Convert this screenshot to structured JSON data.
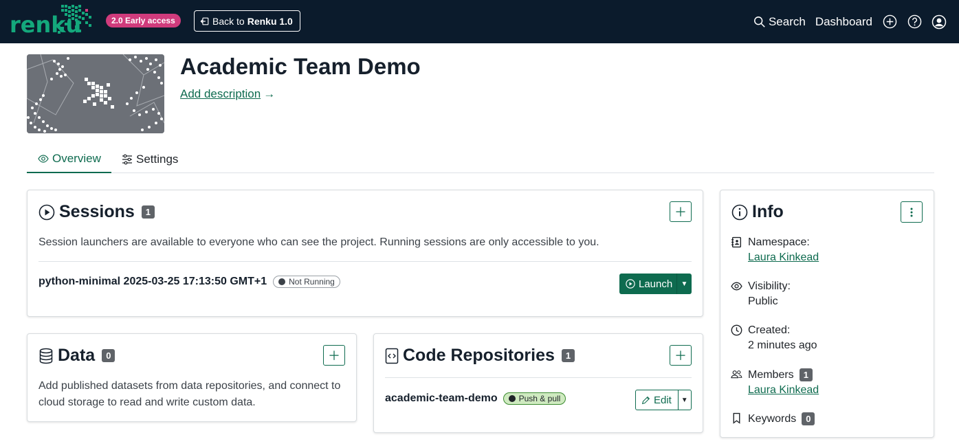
{
  "navbar": {
    "logo_text": "renku",
    "early_access_badge": "2.0 Early access",
    "back_button": {
      "prefix": "Back to ",
      "bold": "Renku 1.0"
    },
    "search_label": "Search",
    "dashboard_label": "Dashboard",
    "icons": [
      "search-icon",
      "plus-circle-icon",
      "help-circle-icon",
      "user-account-icon"
    ]
  },
  "project": {
    "title": "Academic Team Demo",
    "add_description": "Add description",
    "add_description_arrow": "→"
  },
  "tabs": [
    {
      "label": "Overview",
      "active": true,
      "icon": "eye-icon"
    },
    {
      "label": "Settings",
      "active": false,
      "icon": "sliders-icon"
    }
  ],
  "sessions": {
    "title": "Sessions",
    "count": "1",
    "description": "Session launchers are available to everyone who can see the project. Running sessions are only accessible to you.",
    "launcher": {
      "name": "python-minimal 2025-03-25 17:13:50 GMT+1",
      "status": "Not Running",
      "launch_label": "Launch"
    }
  },
  "data_section": {
    "title": "Data",
    "count": "0",
    "description": "Add published datasets from data repositories, and connect to cloud storage to read and write custom data."
  },
  "code_repositories": {
    "title": "Code Repositories",
    "count": "1",
    "repo": {
      "name": "academic-team-demo",
      "permission": "Push & pull",
      "edit_label": "Edit"
    }
  },
  "info": {
    "title": "Info",
    "namespace_label": "Namespace:",
    "namespace_value": "Laura Kinkead",
    "visibility_label": "Visibility:",
    "visibility_value": "Public",
    "created_label": "Created:",
    "created_value": "2 minutes ago",
    "members_label": "Members",
    "members_count": "1",
    "members_value": "Laura Kinkead",
    "keywords_label": "Keywords",
    "keywords_count": "0"
  },
  "colors": {
    "navbar_bg": "#0b1b2c",
    "brand_green": "#0e6b4f",
    "badge_pink": "#d03b7c",
    "logo_green": "#14a87c"
  }
}
